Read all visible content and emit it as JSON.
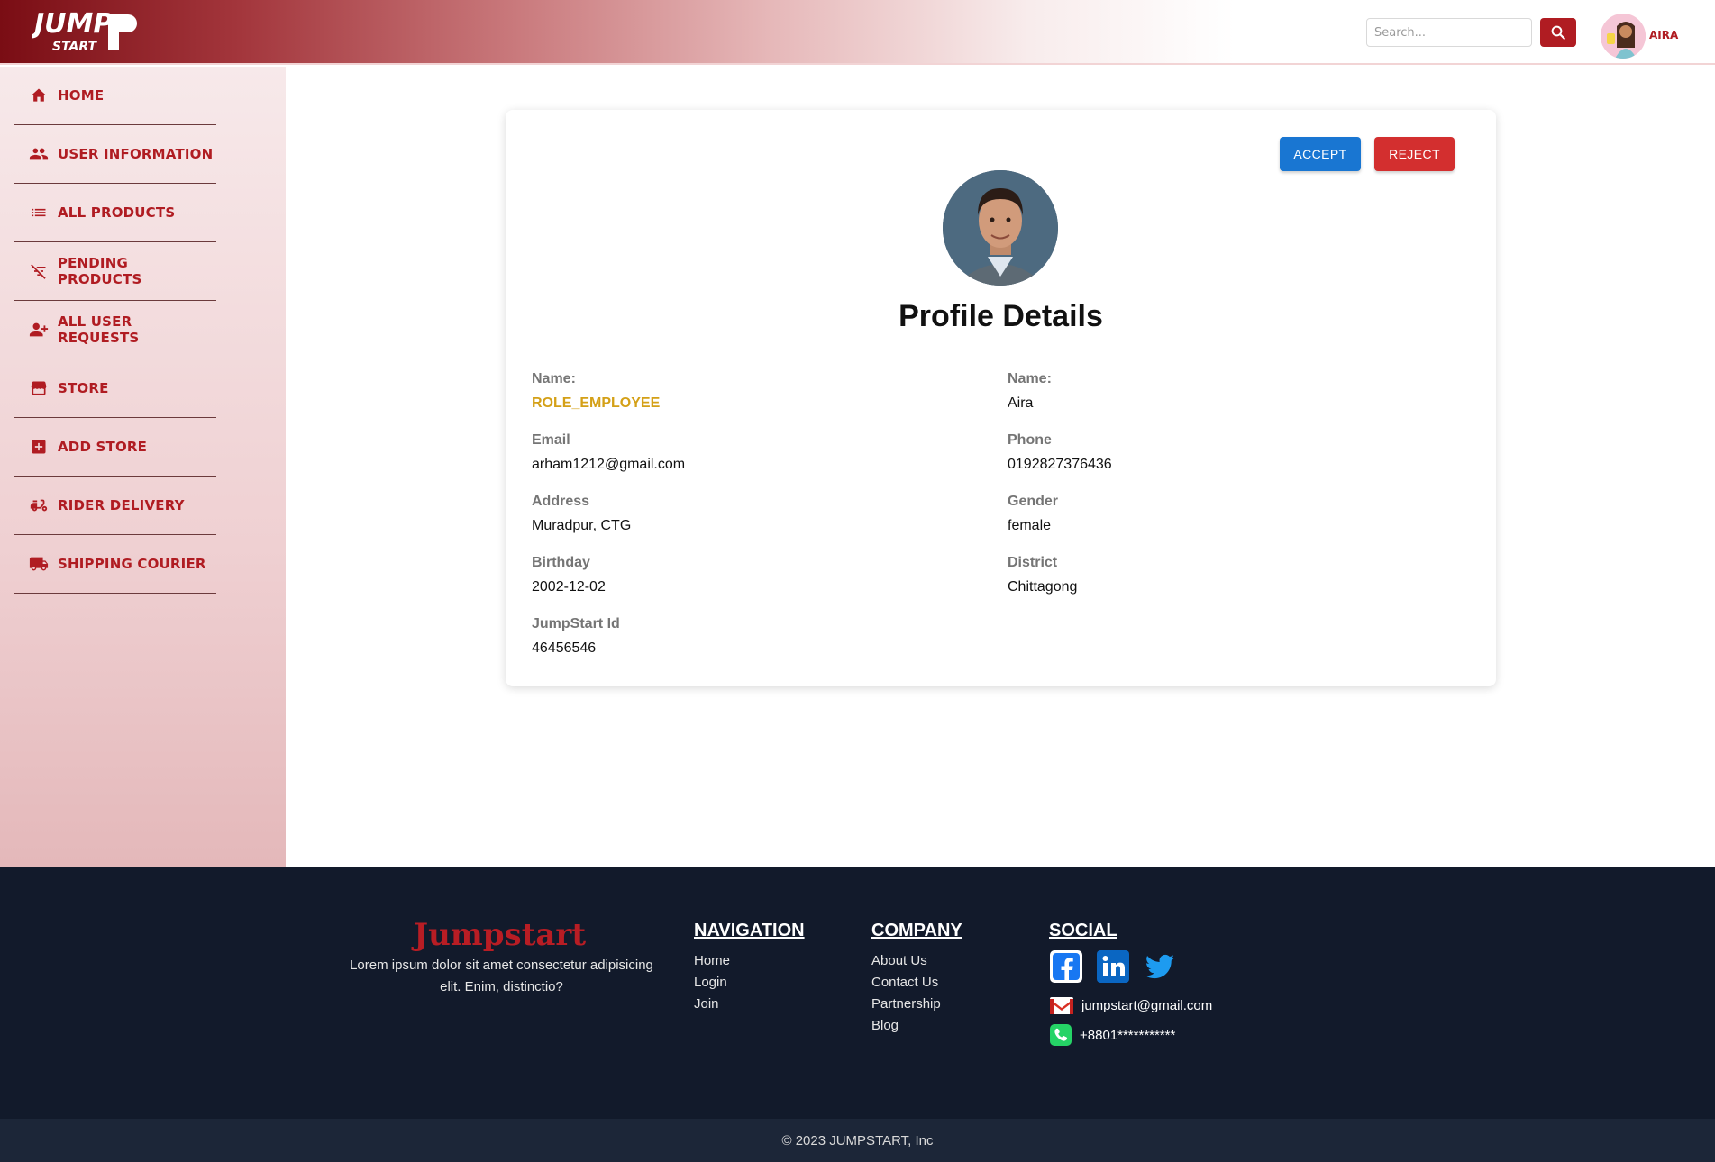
{
  "header": {
    "logo_text_top": "JUMP",
    "logo_text_bottom": "START",
    "search_placeholder": "Search...",
    "search_icon": "magnifier-icon",
    "user_name": "AIRA"
  },
  "sidebar": {
    "items": [
      {
        "label": "HOME",
        "icon": "home-icon"
      },
      {
        "label": "USER INFORMATION",
        "icon": "people-icon"
      },
      {
        "label": "ALL PRODUCTS",
        "icon": "list-icon"
      },
      {
        "label": "PENDING PRODUCTS",
        "icon": "filter-off-icon"
      },
      {
        "label": "ALL USER REQUESTS",
        "icon": "person-add-icon"
      },
      {
        "label": "STORE",
        "icon": "storefront-icon"
      },
      {
        "label": "ADD STORE",
        "icon": "add-box-icon"
      },
      {
        "label": "RIDER DELIVERY",
        "icon": "moped-icon"
      },
      {
        "label": "SHIPPING COURIER",
        "icon": "truck-icon"
      }
    ]
  },
  "profile": {
    "accept_label": "ACCEPT",
    "reject_label": "REJECT",
    "title": "Profile Details",
    "fields_left": [
      {
        "label": "Name:",
        "value": "ROLE_EMPLOYEE"
      },
      {
        "label": "Email",
        "value": "arham1212@gmail.com"
      },
      {
        "label": "Address",
        "value": "Muradpur, CTG"
      },
      {
        "label": "Birthday",
        "value": "2002-12-02"
      },
      {
        "label": "JumpStart Id",
        "value": "46456546"
      }
    ],
    "fields_right": [
      {
        "label": "Name:",
        "value": "Aira"
      },
      {
        "label": "Phone",
        "value": "0192827376436"
      },
      {
        "label": "Gender",
        "value": "female"
      },
      {
        "label": "District",
        "value": "Chittagong"
      }
    ]
  },
  "footer": {
    "brand": "Jumpstart",
    "description": "Lorem ipsum dolor sit amet consectetur adipisicing elit. Enim, distinctio?",
    "navigation": {
      "heading": "NAVIGATION",
      "links": [
        "Home",
        "Login",
        "Join"
      ]
    },
    "company": {
      "heading": "COMPANY",
      "links": [
        "About Us",
        "Contact Us",
        "Partnership",
        "Blog"
      ]
    },
    "social": {
      "heading": "SOCIAL",
      "icons": [
        "facebook-icon",
        "linkedin-icon",
        "twitter-icon"
      ],
      "email": "jumpstart@gmail.com",
      "phone": "+8801***********"
    },
    "copyright": "© 2023 JUMPSTART, Inc"
  },
  "colors": {
    "brand_red": "#b01c22",
    "accept_blue": "#1976d2",
    "reject_red": "#d32f2f",
    "role_gold": "#d4a017",
    "footer_bg": "#121a2b"
  }
}
